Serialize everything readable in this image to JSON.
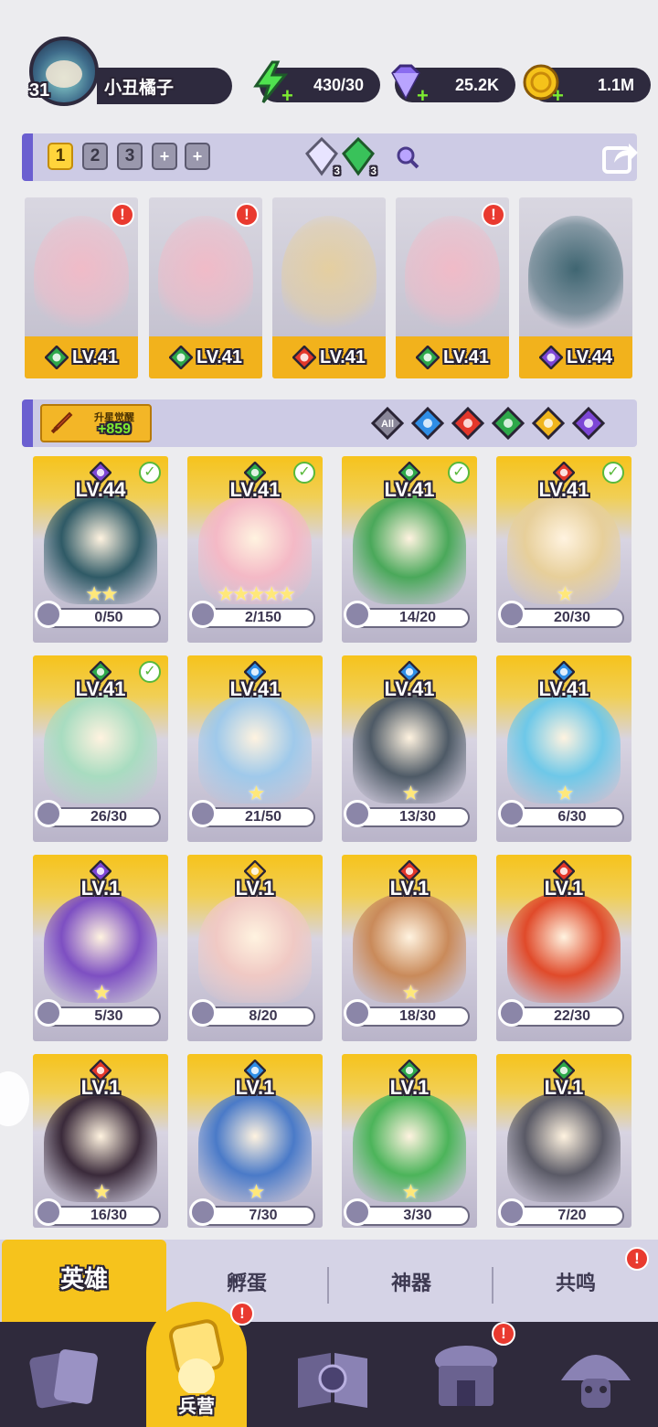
{
  "player": {
    "level": "31",
    "name": "小丑橘子"
  },
  "resources": [
    {
      "name": "energy",
      "icon": "lightning-icon",
      "value": "430/30",
      "color": "#4fe24f"
    },
    {
      "name": "gems",
      "icon": "gem-icon",
      "value": "25.2K",
      "color": "#8a6cf0"
    },
    {
      "name": "coins",
      "icon": "coin-icon",
      "value": "1.1M",
      "color": "#f5c21a"
    }
  ],
  "team_tabs": [
    "1",
    "2",
    "3",
    "+",
    "+"
  ],
  "team_active_tab": "1",
  "crystals": [
    {
      "icon": "white-crystal-icon",
      "count": "3"
    },
    {
      "icon": "green-crystal-icon",
      "count": "3"
    }
  ],
  "team": [
    {
      "level": "LV.41",
      "element": "nature",
      "stars": "★",
      "alert": "!"
    },
    {
      "level": "LV.41",
      "element": "nature",
      "stars": "★★★★★",
      "alert": "!"
    },
    {
      "level": "LV.41",
      "element": "fire",
      "stars": "★",
      "alert": ""
    },
    {
      "level": "LV.41",
      "element": "nature",
      "stars": "",
      "alert": "!"
    },
    {
      "level": "LV.44",
      "element": "dark",
      "stars": "★★",
      "alert": ""
    }
  ],
  "starup": {
    "label": "升星觉醒",
    "count": "+859"
  },
  "filters": [
    {
      "name": "all",
      "label": "All",
      "color": "#8a8799"
    },
    {
      "name": "water",
      "label": "",
      "color": "#2f8ee6"
    },
    {
      "name": "fire",
      "label": "",
      "color": "#e3372a"
    },
    {
      "name": "nature",
      "label": "",
      "color": "#2ea84a"
    },
    {
      "name": "light",
      "label": "",
      "color": "#f0b51c"
    },
    {
      "name": "dark",
      "label": "",
      "color": "#7d46d6"
    }
  ],
  "heroes": [
    {
      "level": "LV.44",
      "element": "dark",
      "stars": "★★",
      "shards": "0/50",
      "checked": true,
      "art": "#2f5a66"
    },
    {
      "level": "LV.41",
      "element": "nature",
      "stars": "★★★★★",
      "shards": "2/150",
      "checked": true,
      "art": "#f4b9c6"
    },
    {
      "level": "LV.41",
      "element": "nature",
      "stars": "",
      "shards": "14/20",
      "checked": true,
      "art": "#4aa85a"
    },
    {
      "level": "LV.41",
      "element": "fire",
      "stars": "★",
      "shards": "20/30",
      "checked": true,
      "art": "#e7cf9a"
    },
    {
      "level": "LV.41",
      "element": "nature",
      "stars": "",
      "shards": "26/30",
      "checked": true,
      "art": "#a8dcc0"
    },
    {
      "level": "LV.41",
      "element": "water",
      "stars": "★",
      "shards": "21/50",
      "checked": false,
      "art": "#9fc9ea"
    },
    {
      "level": "LV.41",
      "element": "water",
      "stars": "★",
      "shards": "13/30",
      "checked": false,
      "art": "#4e5a66"
    },
    {
      "level": "LV.41",
      "element": "water",
      "stars": "★",
      "shards": "6/30",
      "checked": false,
      "art": "#6ec8e8"
    },
    {
      "level": "LV.1",
      "element": "dark",
      "stars": "★",
      "shards": "5/30",
      "checked": false,
      "art": "#7d4fc2"
    },
    {
      "level": "LV.1",
      "element": "light",
      "stars": "",
      "shards": "8/20",
      "checked": false,
      "art": "#f0c9c4"
    },
    {
      "level": "LV.1",
      "element": "fire",
      "stars": "★",
      "shards": "18/30",
      "checked": false,
      "art": "#c98a5a"
    },
    {
      "level": "LV.1",
      "element": "fire",
      "stars": "",
      "shards": "22/30",
      "checked": false,
      "art": "#e04a2a"
    },
    {
      "level": "LV.1",
      "element": "fire",
      "stars": "★",
      "shards": "16/30",
      "checked": false,
      "art": "#3a2a3a"
    },
    {
      "level": "LV.1",
      "element": "water",
      "stars": "★",
      "shards": "7/30",
      "checked": false,
      "art": "#4a7ac8"
    },
    {
      "level": "LV.1",
      "element": "nature",
      "stars": "★",
      "shards": "3/30",
      "checked": false,
      "art": "#4cb45a"
    },
    {
      "level": "LV.1",
      "element": "nature",
      "stars": "",
      "shards": "7/20",
      "checked": false,
      "art": "#5a5a66"
    }
  ],
  "subtabs": [
    {
      "label": "英雄",
      "active": true,
      "alert": ""
    },
    {
      "label": "孵蛋",
      "active": false,
      "alert": ""
    },
    {
      "label": "神器",
      "active": false,
      "alert": ""
    },
    {
      "label": "共鸣",
      "active": false,
      "alert": "!"
    }
  ],
  "bottom_nav": [
    {
      "name": "cards",
      "icon": "cards-icon",
      "label": "",
      "active": false,
      "alert": ""
    },
    {
      "name": "barracks",
      "icon": "barracks-icon",
      "label": "兵营",
      "active": true,
      "alert": "!"
    },
    {
      "name": "map",
      "icon": "map-book-icon",
      "label": "",
      "active": false,
      "alert": ""
    },
    {
      "name": "shop",
      "icon": "shop-icon",
      "label": "",
      "active": false,
      "alert": "!"
    },
    {
      "name": "guild",
      "icon": "mushroom-icon",
      "label": "",
      "active": false,
      "alert": ""
    }
  ],
  "element_colors": {
    "nature": "#2ea84a",
    "fire": "#e3372a",
    "water": "#2f8ee6",
    "light": "#f0b51c",
    "dark": "#7d46d6"
  }
}
